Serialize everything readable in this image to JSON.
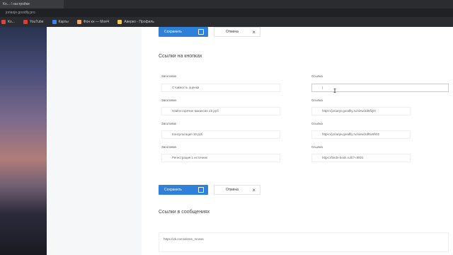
{
  "browser": {
    "tab_title": "Ко... / настройки",
    "url": "jorianje.gооdlly.pro"
  },
  "bookmarks": [
    {
      "label": "Ко...",
      "color": "#d64545"
    },
    {
      "label": "YouTube",
      "color": "#e53935"
    },
    {
      "label": "Карты",
      "color": "#3b82f6"
    },
    {
      "label": "Фон кн — МоеЧ",
      "color": "#f4a261"
    },
    {
      "label": "Аверко - Профиль",
      "color": "#f2c94c"
    }
  ],
  "top_actions": {
    "save_label": "Сохранить",
    "cancel_label": "Отмена"
  },
  "section_buttons": {
    "title": "Ссылки на кнопках",
    "rows": [
      {
        "caption_label": "Заголовок",
        "caption_value": "Стоимость оценки",
        "link_label": "Ссылка",
        "link_value": "|"
      },
      {
        "caption_label": "Заголовок",
        "caption_value": "Найти горячие вакансии 10 руб",
        "link_label": "Ссылка",
        "link_value": "https://jorianje.goodlly.ru/view/2d6f2ji0"
      },
      {
        "caption_label": "Заголовок",
        "caption_value": "Консультация 10 руб",
        "link_label": "Ссылка",
        "link_value": "https://jorianje.goodlly.ru/view/2df6v9h02"
      },
      {
        "caption_label": "Заголовок",
        "caption_value": "Регистрация 1 источник",
        "link_label": "Ссылка",
        "link_value": "https://birds-book.ru/t/?=9921"
      }
    ]
  },
  "bottom_actions": {
    "save_label": "Сохранить",
    "cancel_label": "Отмена"
  },
  "section_messages": {
    "title": "Ссылки в сообщениях",
    "value": "https://vk.com/alsme_mrwas"
  },
  "colors": {
    "accent": "#2f80d8"
  }
}
